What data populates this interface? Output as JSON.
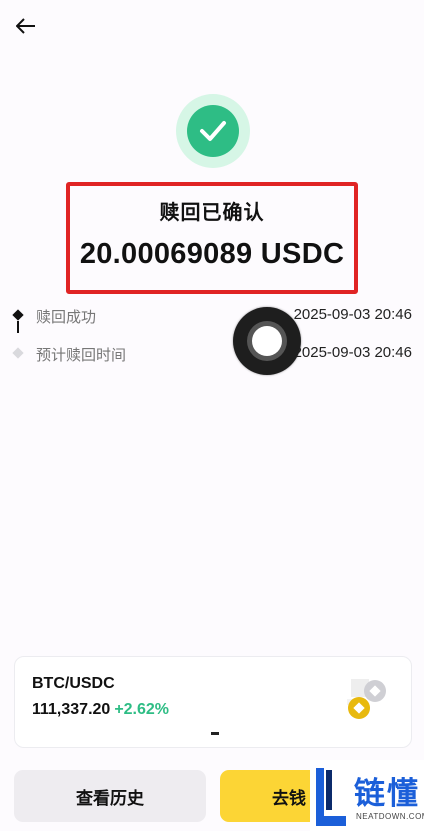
{
  "header": {
    "back_icon": "arrow-left-icon"
  },
  "status": {
    "icon": "check-circle-icon",
    "title": "赎回已确认",
    "amount": "20.00069089 USDC",
    "accent": "#2ebd85",
    "highlight_color": "#e02424"
  },
  "timeline": [
    {
      "label": "赎回成功",
      "time": "2025-09-03 20:46",
      "state": "done"
    },
    {
      "label": "预计赎回时间",
      "time": "2025-09-03 20:46",
      "state": "pending"
    }
  ],
  "ticker": {
    "pair": "BTC/USDC",
    "price": "111,337.20",
    "change": "+2.62%",
    "change_color": "#2ebd85",
    "coin_icon": "coins-icon"
  },
  "actions": {
    "history_label": "查看历史",
    "wallet_label": "去钱"
  },
  "watermark": {
    "text": "链懂",
    "sub": "NEATDOWN.COM"
  }
}
